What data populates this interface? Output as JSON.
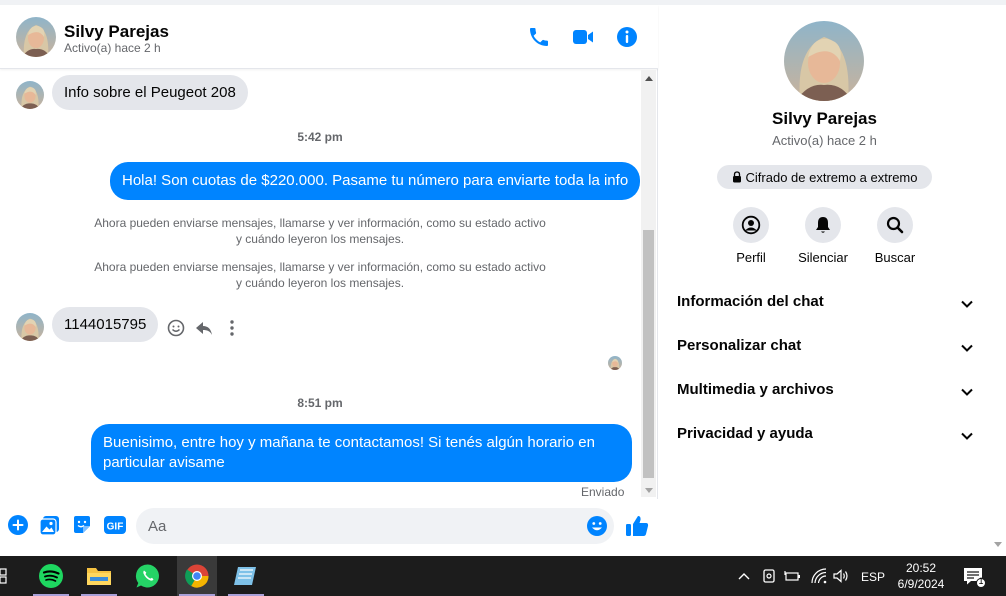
{
  "contact": {
    "name": "Silvy Parejas",
    "status": "Activo(a) hace 2 h"
  },
  "messages": {
    "msg1": "Info sobre el Peugeot 208",
    "time1": "5:42 pm",
    "msg2": "Hola! Son cuotas de $220.000. Pasame tu número para enviarte toda la info",
    "sys1": "Ahora pueden enviarse mensajes, llamarse y ver información, como su estado activo y cuándo leyeron los mensajes.",
    "sys2": "Ahora pueden enviarse mensajes, llamarse y ver información, como su estado activo y cuándo leyeron los mensajes.",
    "msg3": "1144015795",
    "time2": "8:51 pm",
    "msg4": "Buenisimo, entre hoy y mañana te contactamos! Si tenés algún horario en particular avisame",
    "sent_label": "Enviado"
  },
  "composer": {
    "placeholder": "Aa"
  },
  "info_panel": {
    "name": "Silvy Parejas",
    "status": "Activo(a) hace 2 h",
    "e2e": "Cifrado de extremo a extremo",
    "actions": {
      "profile": "Perfil",
      "mute": "Silenciar",
      "search": "Buscar"
    },
    "sections": {
      "chat_info": "Información del chat",
      "customize": "Personalizar chat",
      "media": "Multimedia y archivos",
      "privacy": "Privacidad y ayuda"
    }
  },
  "taskbar": {
    "lang": "ESP",
    "time": "20:52",
    "date": "6/9/2024",
    "notif_count": "1"
  },
  "colors": {
    "accent": "#0084ff",
    "bubble_in": "#e4e6eb",
    "taskbar": "#1c1c1c"
  }
}
